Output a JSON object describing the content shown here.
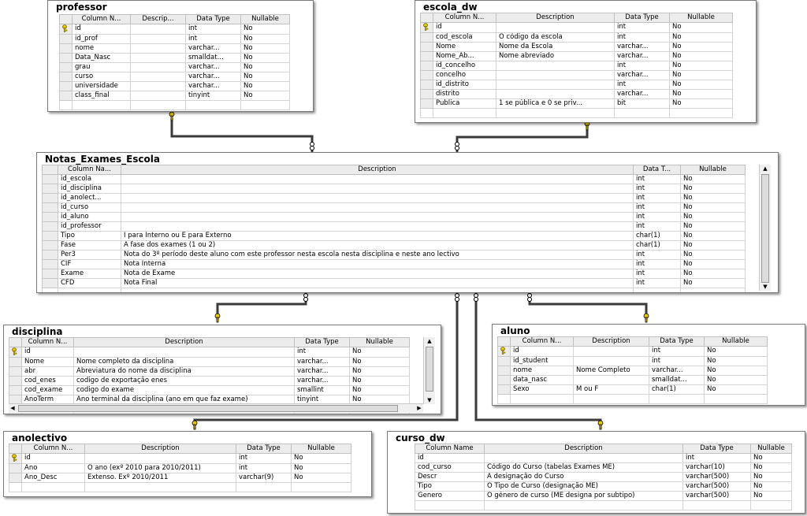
{
  "tables": {
    "professor": {
      "title": "professor",
      "headers": [
        "Column N...",
        "Descrip...",
        "Data Type",
        "Nullable"
      ],
      "rows": [
        {
          "key": true,
          "name": "id",
          "desc": "",
          "type": "int",
          "nullable": "No"
        },
        {
          "key": false,
          "name": "id_prof",
          "desc": "",
          "type": "int",
          "nullable": "No"
        },
        {
          "key": false,
          "name": "nome",
          "desc": "",
          "type": "varchar...",
          "nullable": "No"
        },
        {
          "key": false,
          "name": "Data_Nasc",
          "desc": "",
          "type": "smalldat...",
          "nullable": "No"
        },
        {
          "key": false,
          "name": "grau",
          "desc": "",
          "type": "varchar...",
          "nullable": "No"
        },
        {
          "key": false,
          "name": "curso",
          "desc": "",
          "type": "varchar...",
          "nullable": "No"
        },
        {
          "key": false,
          "name": "universidade",
          "desc": "",
          "type": "varchar...",
          "nullable": "No"
        },
        {
          "key": false,
          "name": "class_final",
          "desc": "",
          "type": "tinyint",
          "nullable": "No"
        }
      ]
    },
    "escola_dw": {
      "title": "escola_dw",
      "headers": [
        "Column N...",
        "Description",
        "Data Type",
        "Nullable"
      ],
      "rows": [
        {
          "key": true,
          "name": "id",
          "desc": "",
          "type": "int",
          "nullable": "No"
        },
        {
          "key": false,
          "name": "cod_escola",
          "desc": "O código da escola",
          "type": "int",
          "nullable": "No"
        },
        {
          "key": false,
          "name": "Nome",
          "desc": "Nome da Escola",
          "type": "varchar...",
          "nullable": "No"
        },
        {
          "key": false,
          "name": "Nome_Ab...",
          "desc": "Nome abreviado",
          "type": "varchar...",
          "nullable": "No"
        },
        {
          "key": false,
          "name": "id_concelho",
          "desc": "",
          "type": "int",
          "nullable": "No"
        },
        {
          "key": false,
          "name": "concelho",
          "desc": "",
          "type": "varchar...",
          "nullable": "No"
        },
        {
          "key": false,
          "name": "id_distrito",
          "desc": "",
          "type": "int",
          "nullable": "No"
        },
        {
          "key": false,
          "name": "distrito",
          "desc": "",
          "type": "varchar...",
          "nullable": "No"
        },
        {
          "key": false,
          "name": "Publica",
          "desc": "1 se pública e 0 se priv...",
          "type": "bit",
          "nullable": "No"
        }
      ]
    },
    "notas": {
      "title": "Notas_Exames_Escola",
      "headers": [
        "Column Na...",
        "Description",
        "Data T...",
        "Nullable"
      ],
      "rows": [
        {
          "key": false,
          "name": "id_escola",
          "desc": "",
          "type": "int",
          "nullable": "No"
        },
        {
          "key": false,
          "name": "id_disciplina",
          "desc": "",
          "type": "int",
          "nullable": "No"
        },
        {
          "key": false,
          "name": "id_anolect...",
          "desc": "",
          "type": "int",
          "nullable": "No"
        },
        {
          "key": false,
          "name": "id_curso",
          "desc": "",
          "type": "int",
          "nullable": "No"
        },
        {
          "key": false,
          "name": "id_aluno",
          "desc": "",
          "type": "int",
          "nullable": "No"
        },
        {
          "key": false,
          "name": "id_professor",
          "desc": "",
          "type": "int",
          "nullable": "No"
        },
        {
          "key": false,
          "name": "Tipo",
          "desc": "I para Interno ou E para Externo",
          "type": "char(1)",
          "nullable": "No"
        },
        {
          "key": false,
          "name": "Fase",
          "desc": "A fase dos exames (1 ou 2)",
          "type": "char(1)",
          "nullable": "No"
        },
        {
          "key": false,
          "name": "Per3",
          "desc": "Nota do 3º período deste aluno com este professor nesta escola nesta disciplina e neste ano lectivo",
          "type": "int",
          "nullable": "No"
        },
        {
          "key": false,
          "name": "CIF",
          "desc": "Nota Interna",
          "type": "int",
          "nullable": "No"
        },
        {
          "key": false,
          "name": "Exame",
          "desc": "Nota de Exame",
          "type": "int",
          "nullable": "No"
        },
        {
          "key": false,
          "name": "CFD",
          "desc": "Nota Final",
          "type": "int",
          "nullable": "No"
        }
      ]
    },
    "disciplina": {
      "title": "disciplina",
      "headers": [
        "Column N...",
        "Description",
        "Data Type",
        "Nullable"
      ],
      "rows": [
        {
          "key": true,
          "name": "id",
          "desc": "",
          "type": "int",
          "nullable": "No"
        },
        {
          "key": false,
          "name": "Nome",
          "desc": "Nome completo da disciplina",
          "type": "varchar...",
          "nullable": "No"
        },
        {
          "key": false,
          "name": "abr",
          "desc": "Abreviatura do nome da disciplina",
          "type": "varchar...",
          "nullable": "No"
        },
        {
          "key": false,
          "name": "cod_enes",
          "desc": "codigo de exportação enes",
          "type": "varchar...",
          "nullable": "No"
        },
        {
          "key": false,
          "name": "cod_exame",
          "desc": "codigo do exame",
          "type": "smallint",
          "nullable": "No"
        },
        {
          "key": false,
          "name": "AnoTerm",
          "desc": "Ano terminal da disciplina (ano em que faz exame)",
          "type": "tinyint",
          "nullable": "No"
        }
      ]
    },
    "aluno": {
      "title": "aluno",
      "headers": [
        "Column N...",
        "Description",
        "Data Type",
        "Nullable"
      ],
      "rows": [
        {
          "key": true,
          "name": "id",
          "desc": "",
          "type": "int",
          "nullable": "No"
        },
        {
          "key": false,
          "name": "id_student",
          "desc": "",
          "type": "int",
          "nullable": "No"
        },
        {
          "key": false,
          "name": "nome",
          "desc": "Nome Completo",
          "type": "varchar...",
          "nullable": "No"
        },
        {
          "key": false,
          "name": "data_nasc",
          "desc": "",
          "type": "smalldat...",
          "nullable": "No"
        },
        {
          "key": false,
          "name": "Sexo",
          "desc": "M ou F",
          "type": "char(1)",
          "nullable": "No"
        }
      ]
    },
    "anolectivo": {
      "title": "anolectivo",
      "headers": [
        "Column N...",
        "Description",
        "Data Type",
        "Nullable"
      ],
      "rows": [
        {
          "key": true,
          "name": "id",
          "desc": "",
          "type": "int",
          "nullable": "No"
        },
        {
          "key": false,
          "name": "Ano",
          "desc": "O ano (exº 2010 para 2010/2011)",
          "type": "int",
          "nullable": "No"
        },
        {
          "key": false,
          "name": "Ano_Desc",
          "desc": "Extenso. Exº 2010/2011",
          "type": "varchar(9)",
          "nullable": "No"
        }
      ]
    },
    "curso_dw": {
      "title": "curso_dw",
      "headers": [
        "Column Name",
        "Description",
        "Data Type",
        "Nullable"
      ],
      "rows": [
        {
          "key": true,
          "name": "id",
          "desc": "",
          "type": "int",
          "nullable": "No"
        },
        {
          "key": false,
          "name": "cod_curso",
          "desc": "Código do Curso (tabelas Exames ME)",
          "type": "varchar(10)",
          "nullable": "No"
        },
        {
          "key": false,
          "name": "Descr",
          "desc": "A designação do Curso",
          "type": "varchar(500)",
          "nullable": "No"
        },
        {
          "key": false,
          "name": "Tipo",
          "desc": "O Tipo de Curso (designação ME)",
          "type": "varchar(500)",
          "nullable": "No"
        },
        {
          "key": false,
          "name": "Genero",
          "desc": "O género de curso (ME designa por subtipo)",
          "type": "varchar(500)",
          "nullable": "No"
        }
      ]
    }
  },
  "relationships": [
    {
      "from": "professor",
      "to": "Notas_Exames_Escola"
    },
    {
      "from": "escola_dw",
      "to": "Notas_Exames_Escola"
    },
    {
      "from": "disciplina",
      "to": "Notas_Exames_Escola"
    },
    {
      "from": "aluno",
      "to": "Notas_Exames_Escola"
    },
    {
      "from": "anolectivo",
      "to": "Notas_Exames_Escola"
    },
    {
      "from": "curso_dw",
      "to": "Notas_Exames_Escola"
    }
  ],
  "colors": {
    "key_icon": "#e8c800",
    "line": "#404040",
    "header_bg": "#ececec"
  }
}
